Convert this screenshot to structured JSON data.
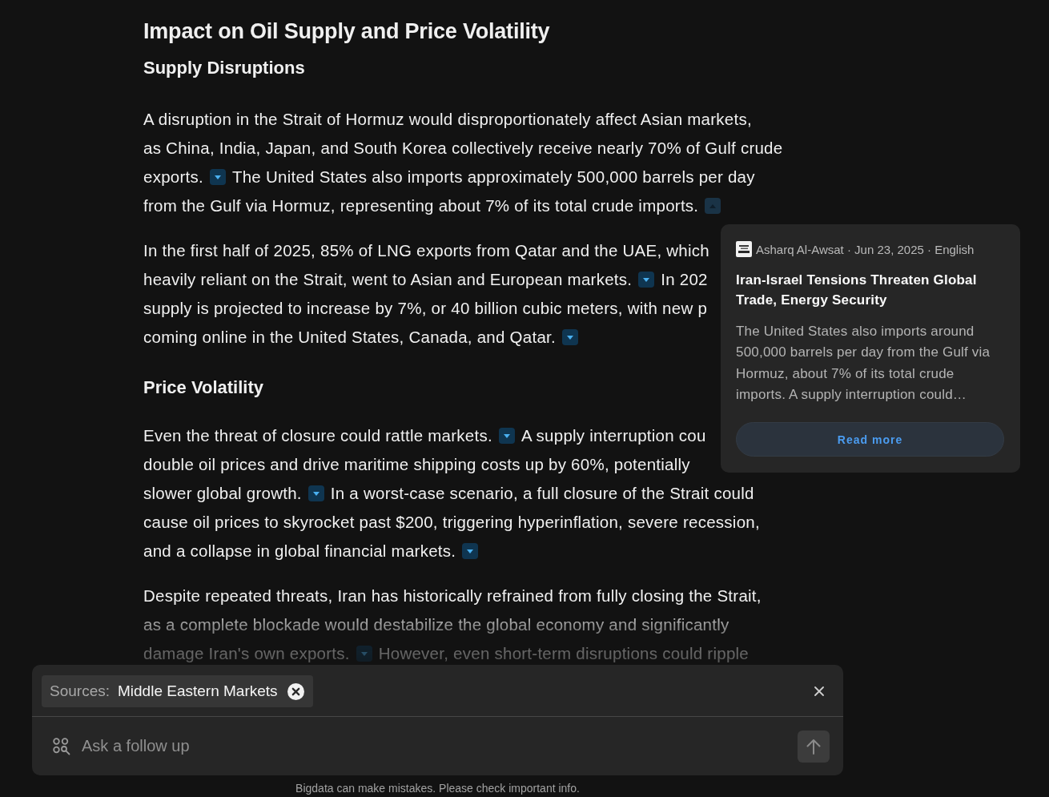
{
  "article": {
    "title": "Impact on Oil Supply and Price Volatility",
    "sections": [
      {
        "heading": "Supply Disruptions",
        "paragraphs": [
          {
            "lines": [
              {
                "segments": [
                  {
                    "kind": "text",
                    "text": "A disruption in the Strait of Hormuz would disproportionately affect Asian markets,"
                  }
                ]
              },
              {
                "segments": [
                  {
                    "kind": "text",
                    "text": "as China, India, Japan, and South Korea collectively receive nearly 70% of Gulf crude"
                  }
                ]
              },
              {
                "segments": [
                  {
                    "kind": "text",
                    "text": "exports."
                  },
                  {
                    "kind": "citation",
                    "expanded": false
                  },
                  {
                    "kind": "text",
                    "text": "The United States also imports approximately 500,000 barrels per day"
                  }
                ]
              },
              {
                "segments": [
                  {
                    "kind": "text",
                    "text": "from the Gulf via Hormuz, representing about 7% of its total crude imports."
                  },
                  {
                    "kind": "citation",
                    "expanded": true
                  }
                ]
              }
            ]
          },
          {
            "lines": [
              {
                "segments": [
                  {
                    "kind": "text",
                    "text": "In the first half of 2025, 85% of LNG exports from Qatar and the UAE, which"
                  }
                ]
              },
              {
                "segments": [
                  {
                    "kind": "text",
                    "text": "heavily reliant on the Strait, went to Asian and European markets."
                  },
                  {
                    "kind": "citation",
                    "expanded": false
                  },
                  {
                    "kind": "text",
                    "text": "In 202"
                  }
                ]
              },
              {
                "segments": [
                  {
                    "kind": "text",
                    "text": "supply is projected to increase by 7%, or 40 billion cubic meters, with new p"
                  }
                ]
              },
              {
                "segments": [
                  {
                    "kind": "text",
                    "text": "coming online in the United States, Canada, and Qatar."
                  },
                  {
                    "kind": "citation",
                    "expanded": false
                  }
                ]
              }
            ]
          }
        ]
      },
      {
        "heading": "Price Volatility",
        "paragraphs": [
          {
            "lines": [
              {
                "segments": [
                  {
                    "kind": "text",
                    "text": "Even the threat of closure could rattle markets."
                  },
                  {
                    "kind": "citation",
                    "expanded": false
                  },
                  {
                    "kind": "text",
                    "text": "A supply interruption cou"
                  }
                ]
              },
              {
                "segments": [
                  {
                    "kind": "text",
                    "text": "double oil prices and drive maritime shipping costs up by 60%, potentially"
                  }
                ]
              },
              {
                "segments": [
                  {
                    "kind": "text",
                    "text": "slower global growth."
                  },
                  {
                    "kind": "citation",
                    "expanded": false
                  },
                  {
                    "kind": "text",
                    "text": "In a worst-case scenario, a full closure of the Strait could"
                  }
                ]
              },
              {
                "segments": [
                  {
                    "kind": "text",
                    "text": "cause oil prices to skyrocket past $200, triggering hyperinflation, severe recession,"
                  }
                ]
              },
              {
                "segments": [
                  {
                    "kind": "text",
                    "text": "and a collapse in global financial markets."
                  },
                  {
                    "kind": "citation",
                    "expanded": false
                  }
                ]
              }
            ]
          },
          {
            "lines": [
              {
                "segments": [
                  {
                    "kind": "text",
                    "text": "Despite repeated threats, Iran has historically refrained from fully closing the Strait,"
                  }
                ]
              },
              {
                "segments": [
                  {
                    "kind": "text",
                    "text": "as a complete blockade would destabilize the global economy and significantly"
                  }
                ]
              },
              {
                "segments": [
                  {
                    "kind": "text",
                    "text": "damage Iran's own exports."
                  },
                  {
                    "kind": "citation",
                    "expanded": false
                  },
                  {
                    "kind": "text",
                    "text": "However, even short-term disruptions could ripple"
                  }
                ]
              }
            ]
          }
        ]
      }
    ]
  },
  "source_popover": {
    "meta": "Asharq Al-Awsat · Jun 23, 2025 · English",
    "title": "Iran-Israel Tensions Threaten Global Trade, Energy Security",
    "snippet": "The United States also imports around 500,000 barrels per day from the Gulf via Hormuz, about 7% of its total crude imports. A supply interruption could…",
    "button": "Read more"
  },
  "composer": {
    "sources_chip": {
      "label": "Sources:",
      "value": "Middle Eastern Markets"
    },
    "input": {
      "placeholder": "Ask a follow up"
    },
    "send_button": {
      "disabled": true
    }
  },
  "disclaimer": "Bigdata can make mistakes. Please check important info."
}
